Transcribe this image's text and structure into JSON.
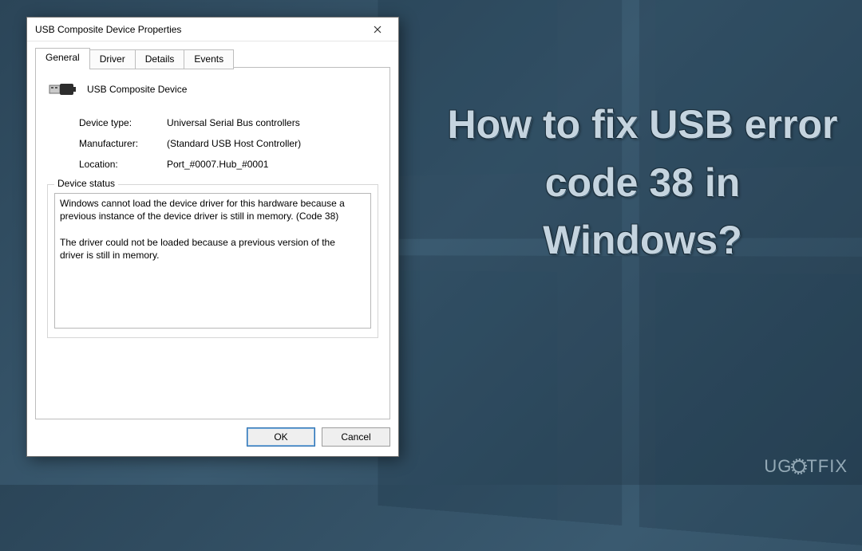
{
  "background": {
    "headline": "How to fix USB error code 38 in Windows?",
    "watermark_prefix": "UG",
    "watermark_suffix": "TFIX"
  },
  "dialog": {
    "title": "USB Composite Device Properties",
    "tabs": [
      {
        "label": "General",
        "active": true
      },
      {
        "label": "Driver",
        "active": false
      },
      {
        "label": "Details",
        "active": false
      },
      {
        "label": "Events",
        "active": false
      }
    ],
    "device_name": "USB Composite Device",
    "properties": {
      "device_type_label": "Device type:",
      "device_type_value": "Universal Serial Bus controllers",
      "manufacturer_label": "Manufacturer:",
      "manufacturer_value": "(Standard USB Host Controller)",
      "location_label": "Location:",
      "location_value": "Port_#0007.Hub_#0001"
    },
    "status": {
      "legend": "Device status",
      "text": "Windows cannot load the device driver for this hardware because a previous instance of the device driver is still in memory. (Code 38)\n\nThe driver could not be loaded because a previous version of the driver is still in memory."
    },
    "buttons": {
      "ok": "OK",
      "cancel": "Cancel"
    }
  }
}
